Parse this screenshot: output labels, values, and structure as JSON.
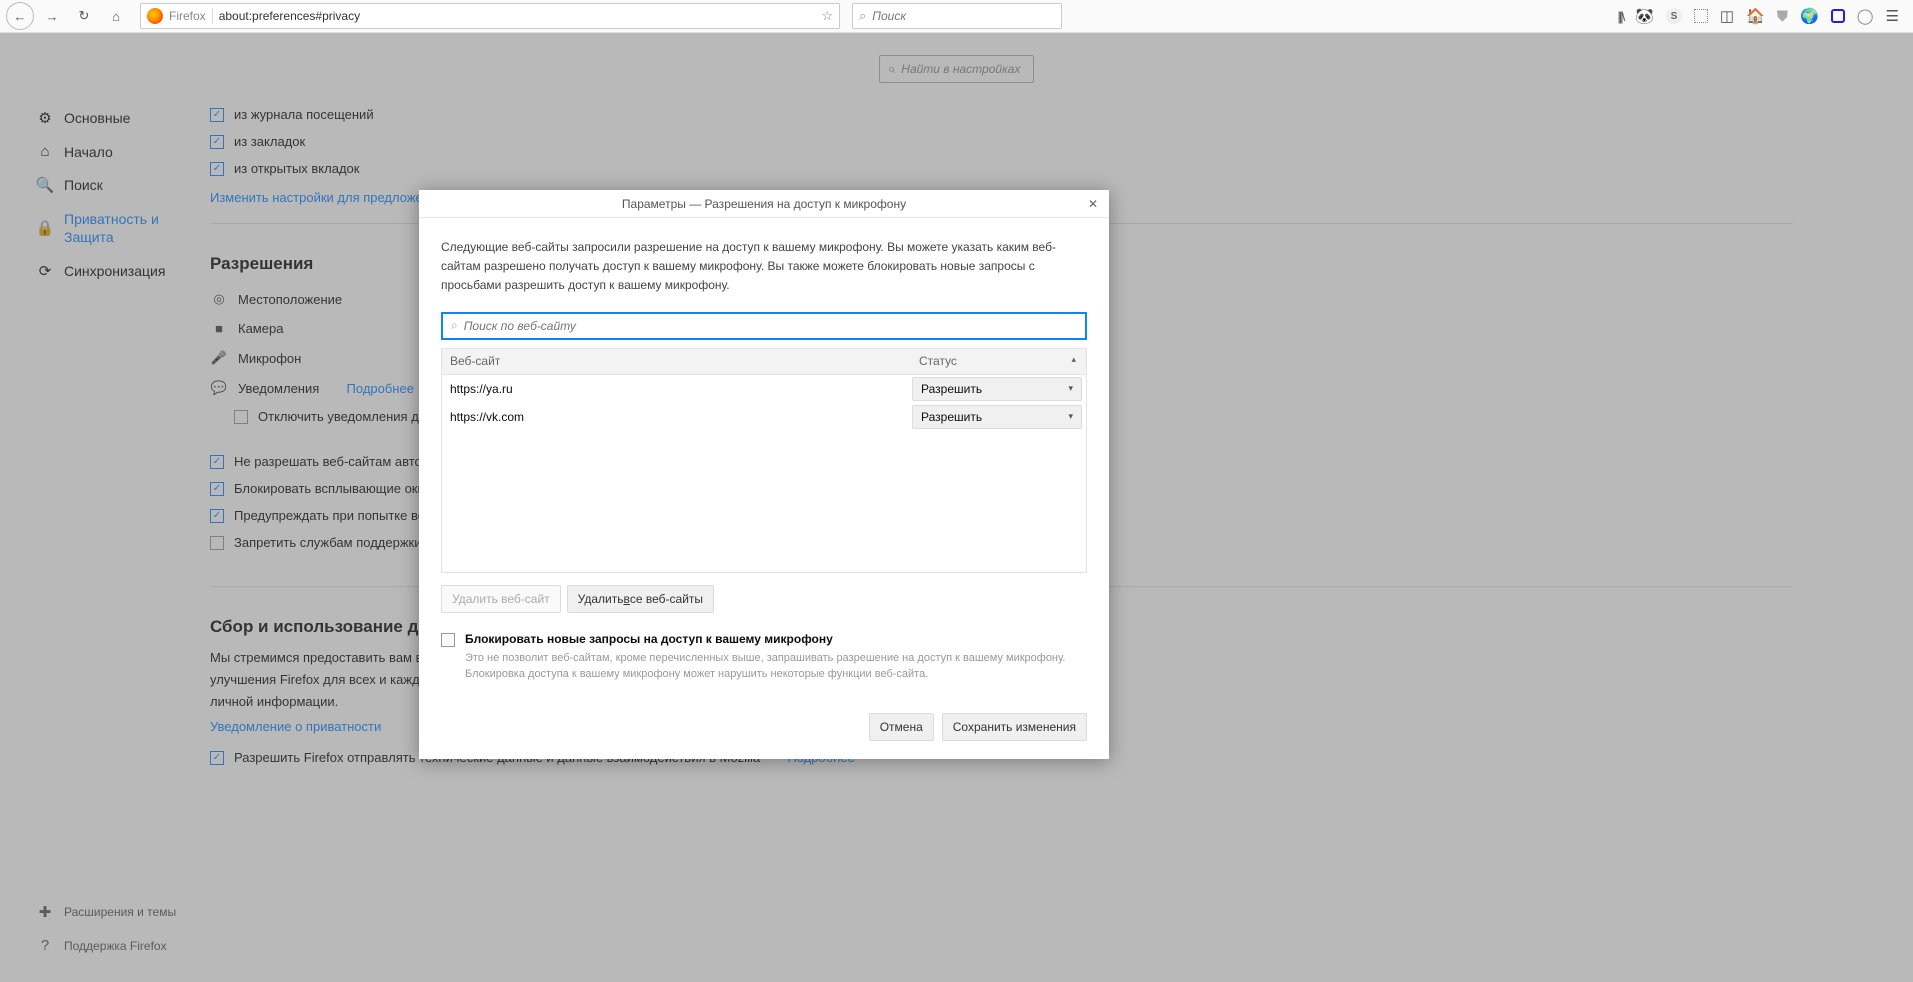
{
  "toolbar": {
    "url": "about:preferences#privacy",
    "firefox_label": "Firefox",
    "search_placeholder": "Поиск"
  },
  "page": {
    "search_placeholder": "Найти в настройках"
  },
  "sidebar": {
    "items": [
      {
        "label": "Основные"
      },
      {
        "label": "Начало"
      },
      {
        "label": "Поиск"
      },
      {
        "label": "Приватность и Защита"
      },
      {
        "label": "Синхронизация"
      }
    ],
    "footer": [
      {
        "label": "Расширения и темы"
      },
      {
        "label": "Поддержка Firefox"
      }
    ]
  },
  "content": {
    "chk_history": "из журнала посещений",
    "chk_bookmarks": "из закладок",
    "chk_tabs": "из открытых вкладок",
    "change_link": "Изменить настройки для предложен",
    "section_perms": "Разрешения",
    "perm_location": "Местоположение",
    "perm_camera": "Камера",
    "perm_microphone": "Микрофон",
    "perm_notifications": "Уведомления",
    "learn_more": "Подробнее",
    "chk_disable_notif": "Отключить уведомления до",
    "chk_no_autoplay": "Не разрешать веб-сайтам автом",
    "chk_block_popups": "Блокировать всплывающие окна",
    "chk_warn_install": "Предупреждать при попытке ве",
    "chk_no_support": "Запретить службам поддержки д",
    "section_data": "Сбор и использование дан",
    "data_text": "Мы стремимся предоставить вам выбор и собирать только то, что нам нужно, для выпуска и улучшения Firefox для всех и каждого. Мы всегда спрашиваем разрешения перед получением личной информации.",
    "privacy_link": "Уведомление о приватности",
    "chk_telemetry": "Разрешить Firefox отправлять технические данные и данные взаимодействия в Mozilla"
  },
  "dialog": {
    "title": "Параметры — Разрешения на доступ к микрофону",
    "intro": "Следующие веб-сайты запросили разрешение на доступ к вашему микрофону. Вы можете указать каким веб-сайтам разрешено получать доступ к вашему микрофону. Вы также можете блокировать новые запросы с просьбами разрешить доступ к вашему микрофону.",
    "search_placeholder": "Поиск по веб-сайту",
    "col_site": "Веб-сайт",
    "col_status": "Статус",
    "rows": [
      {
        "site": "https://ya.ru",
        "status": "Разрешить"
      },
      {
        "site": "https://vk.com",
        "status": "Разрешить"
      }
    ],
    "btn_remove": "Удалить веб-сайт",
    "btn_remove_all_prefix": "Удалить ",
    "btn_remove_all_ul": "в",
    "btn_remove_all_suffix": "се веб-сайты",
    "block_label": "Блокировать новые запросы на доступ к вашему микрофону",
    "block_sub": "Это не позволит веб-сайтам, кроме перечисленных выше, запрашивать разрешение на доступ к вашему микрофону. Блокировка доступа к вашему микрофону может нарушить некоторые функции веб-сайта.",
    "btn_cancel": "Отмена",
    "btn_save": "Сохранить изменения"
  }
}
